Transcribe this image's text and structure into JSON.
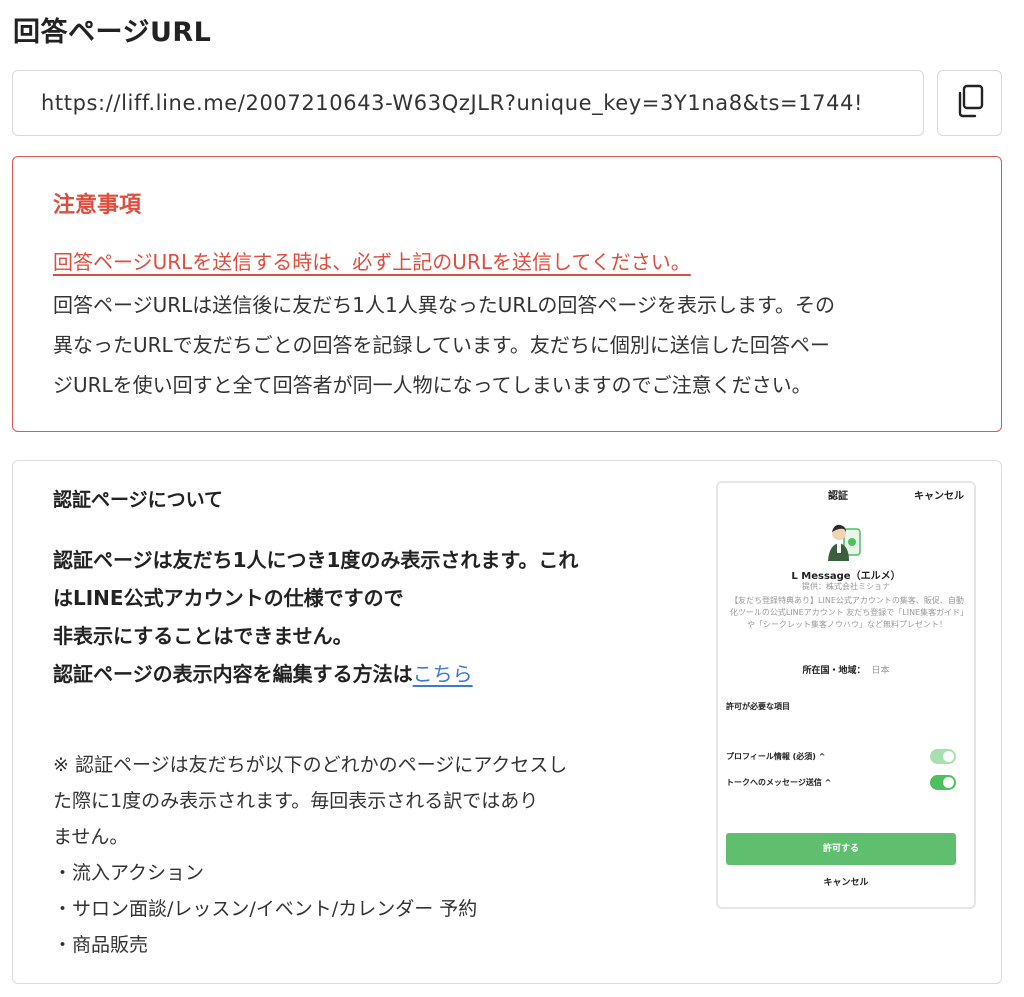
{
  "page": {
    "title": "回答ページURL",
    "url_value": "https://liff.line.me/2007210643-W63QzJLR?unique_key=3Y1na8&ts=1744!"
  },
  "notice": {
    "title": "注意事項",
    "link_text": "回答ページURLを送信する時は、必ず上記のURLを送信してください。",
    "body_lines": [
      "回答ページURLは送信後に友だち1人1人異なったURLの回答ページを表示します。その",
      "異なったURLで友だちごとの回答を記録しています。友だちに個別に送信した回答ペー",
      "ジURLを使い回すと全て回答者が同一人物になってしまいますのでご注意ください。"
    ]
  },
  "auth": {
    "title": "認証ページについて",
    "main_lines": [
      "認証ページは友だち1人につき1度のみ表示されます。これ",
      "はLINE公式アカウントの仕様ですので",
      "非表示にすることはできません。"
    ],
    "edit_text": "認証ページの表示内容を編集する方法は",
    "edit_link": "こちら",
    "note_lines": [
      "※ 認証ページは友だちが以下のどれかのページにアクセスし",
      "た際に1度のみ表示されます。毎回表示される訳ではあり",
      "ません。",
      "・流入アクション",
      "・サロン面談/レッスン/イベント/カレンダー 予約",
      "・商品販売"
    ]
  },
  "preview": {
    "header_title": "認証",
    "header_cancel": "キャンセル",
    "name": "L Message（エルメ）",
    "provider": "提供：株式会社ミショナ",
    "description": "【友だち登録特典あり】LINE公式アカウントの集客、販促、自動化ツールの公式LINEアカウント 友だち登録で「LINE集客ガイド」や「シークレット集客ノウハウ」など無料プレゼント！",
    "region_label": "所在国・地域：",
    "region_value": "日本",
    "permissions_title": "許可が必要な項目",
    "permissions": [
      {
        "label": "プロフィール情報 (必須) ^",
        "enabled": true
      },
      {
        "label": "トークへのメッセージ送信 ^",
        "enabled": true
      }
    ],
    "allow_button": "許可する",
    "cancel_button": "キャンセル"
  },
  "colors": {
    "accent_red": "#e04d3e",
    "link_blue": "#3a7bd5",
    "line_green": "#4cbf5e"
  },
  "icons": {
    "copy": "copy-icon",
    "avatar": "avatar-icon"
  }
}
